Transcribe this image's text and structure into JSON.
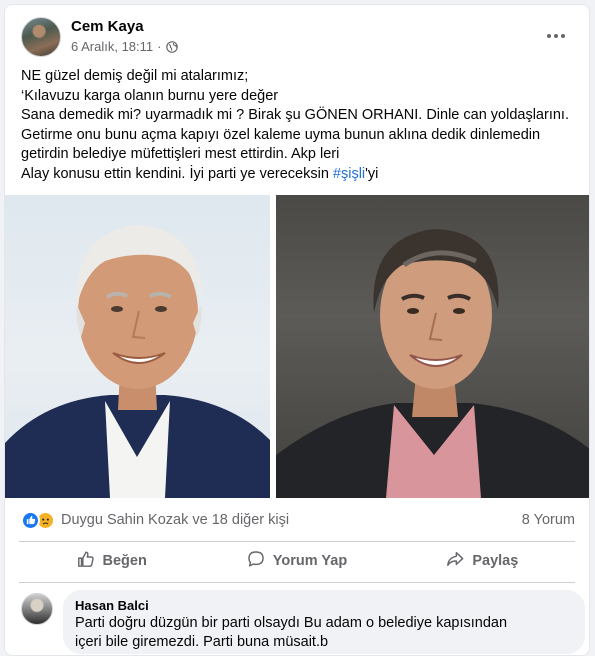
{
  "post": {
    "author": "Cem Kaya",
    "date": "6 Aralık, 18:11",
    "separator": "·",
    "privacy_icon": "globe-icon",
    "more_icon": "more-options-icon",
    "text_lines": [
      "NE güzel demiş değil mi atalarımız;",
      "‘Kılavuzu karga olanın burnu yere değer",
      "Sana demedik mi? uyarmadık mi ? Birak şu GÖNEN ORHANI. Dinle can yoldaşlarını.",
      "Getirme onu bunu açma kapıyı özel kaleme uyma bunun aklına dedik dinlemedin",
      "getirdin belediye müfettişleri mest ettirdin. Akp leri"
    ],
    "last_line_prefix": "Alay konusu ettin kendini. İyi parti ye vereceksin ",
    "hashtag": "#şişli",
    "last_line_suffix": "'yi"
  },
  "reactions": {
    "icons": [
      "like-react-icon",
      "sad-react-icon"
    ],
    "names": "Duygu Sahin Kozak ve 18 diğer kişi",
    "comment_count": "8 Yorum"
  },
  "actions": {
    "like_label": "Beğen",
    "comment_label": "Yorum Yap",
    "share_label": "Paylaş"
  },
  "comment": {
    "author": "Hasan Balci",
    "lines": [
      "Parti doğru düzgün bir parti olsaydı Bu adam o belediye kapısından",
      "içeri bile giremezdi. Parti buna müsait.b"
    ]
  },
  "colors": {
    "accent": "#216fdb",
    "like_blue": "#1877f2",
    "sad_yellow": "#f7b125",
    "secondary_text": "#65676b"
  }
}
